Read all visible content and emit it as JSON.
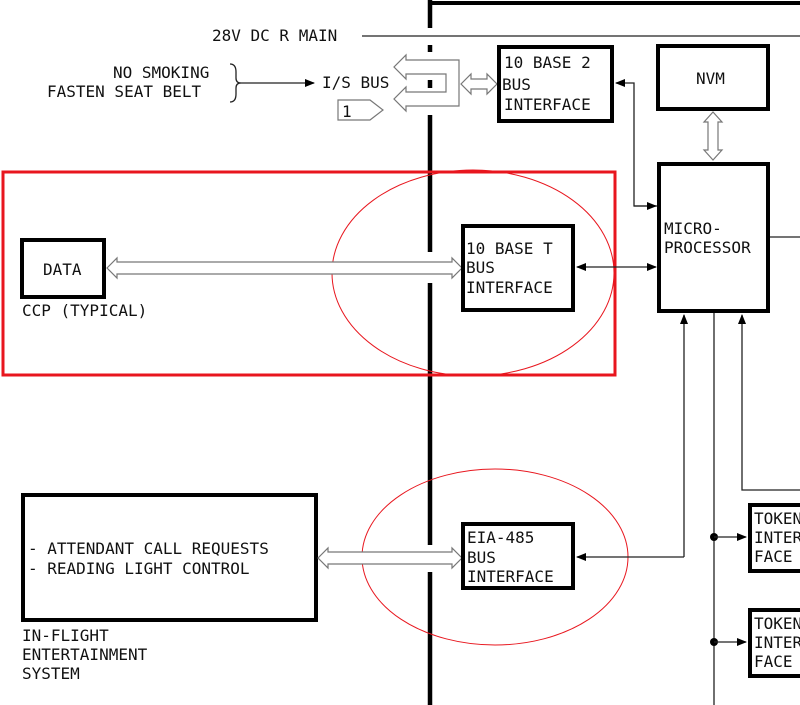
{
  "power": {
    "label": "28V DC R MAIN"
  },
  "inputs": {
    "line1": "NO SMOKING",
    "line2": "FASTEN SEAT BELT"
  },
  "is_bus": {
    "label": "I/S BUS",
    "ref_tag": "1"
  },
  "boxes": {
    "base2": [
      "10 BASE 2",
      "BUS",
      "INTERFACE"
    ],
    "nvm": "NVM",
    "micro": [
      "MICRO-",
      "PROCESSOR"
    ],
    "ccp_data": "DATA",
    "ccp_label": "CCP (TYPICAL)",
    "base_t": [
      "10 BASE T",
      "BUS",
      "INTERFACE"
    ],
    "ife": [
      "- ATTENDANT CALL REQUESTS",
      "- READING LIGHT CONTROL"
    ],
    "ife_label": [
      "IN-FLIGHT",
      "ENTERTAINMENT",
      "SYSTEM"
    ],
    "eia": [
      "EIA-485",
      "BUS",
      "INTERFACE"
    ],
    "token1": [
      "TOKEN",
      "INTER",
      "FACE"
    ],
    "token2": [
      "TOKEN",
      "INTER",
      "FACE"
    ]
  },
  "highlight_color": "#e8161e"
}
